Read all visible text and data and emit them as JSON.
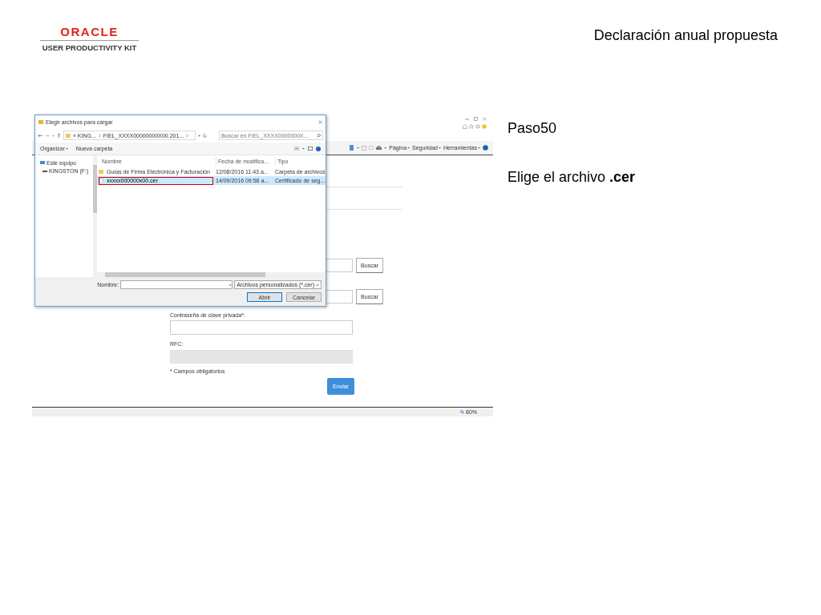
{
  "header": {
    "logo": {
      "brand": "ORACLE",
      "product": "USER PRODUCTIVITY KIT"
    },
    "title": "Declaración anual propuesta"
  },
  "step": {
    "number": "Paso50",
    "instruction": "Elige el archivo **.cer**"
  },
  "browser": {
    "toolbar": [
      "Página",
      "Seguridad",
      "Herramientas"
    ],
    "form": {
      "fields": [
        {
          "kind": "file",
          "button": "Buscar"
        },
        {
          "kind": "file",
          "button": "Buscar"
        },
        {
          "kind": "password",
          "label": "Contraseña de clave privada*:"
        },
        {
          "kind": "readonly",
          "label": "RFC:"
        }
      ],
      "note": "* Campos obligatorios",
      "submit": "Enviar"
    },
    "zoom": "80%"
  },
  "dialog": {
    "title": "Elegir archivos para cargar",
    "path": [
      "« KING...",
      "FIEL_XXXX00000000X00.201..."
    ],
    "search": {
      "placeholder": "Buscar en FIEL_XXXX0000000X..."
    },
    "commands": [
      "Organizar",
      "Nueva carpeta"
    ],
    "nav": [
      {
        "label": "Este equipo",
        "kind": "computer"
      },
      {
        "label": "KINGSTON (F:)",
        "kind": "drive"
      }
    ],
    "columns": [
      "Nombre",
      "Fecha de modifica...",
      "Tipo"
    ],
    "rows": [
      {
        "kind": "folder",
        "name": "Guías de Firma Electrónica y Facturación",
        "modified": "12/08/2016 11:43 a...",
        "type": "Carpeta de archivos",
        "selected": false
      },
      {
        "kind": "file",
        "name": "xxxxx000000x00.cer",
        "modified": "14/09/2016 09:58 a...",
        "type": "Certificado de seg...",
        "selected": true
      }
    ],
    "filename_label": "Nombre:",
    "filter": "Archivos personalizados (*.cer)",
    "buttons": [
      "Abrir",
      "Cancelar"
    ]
  }
}
